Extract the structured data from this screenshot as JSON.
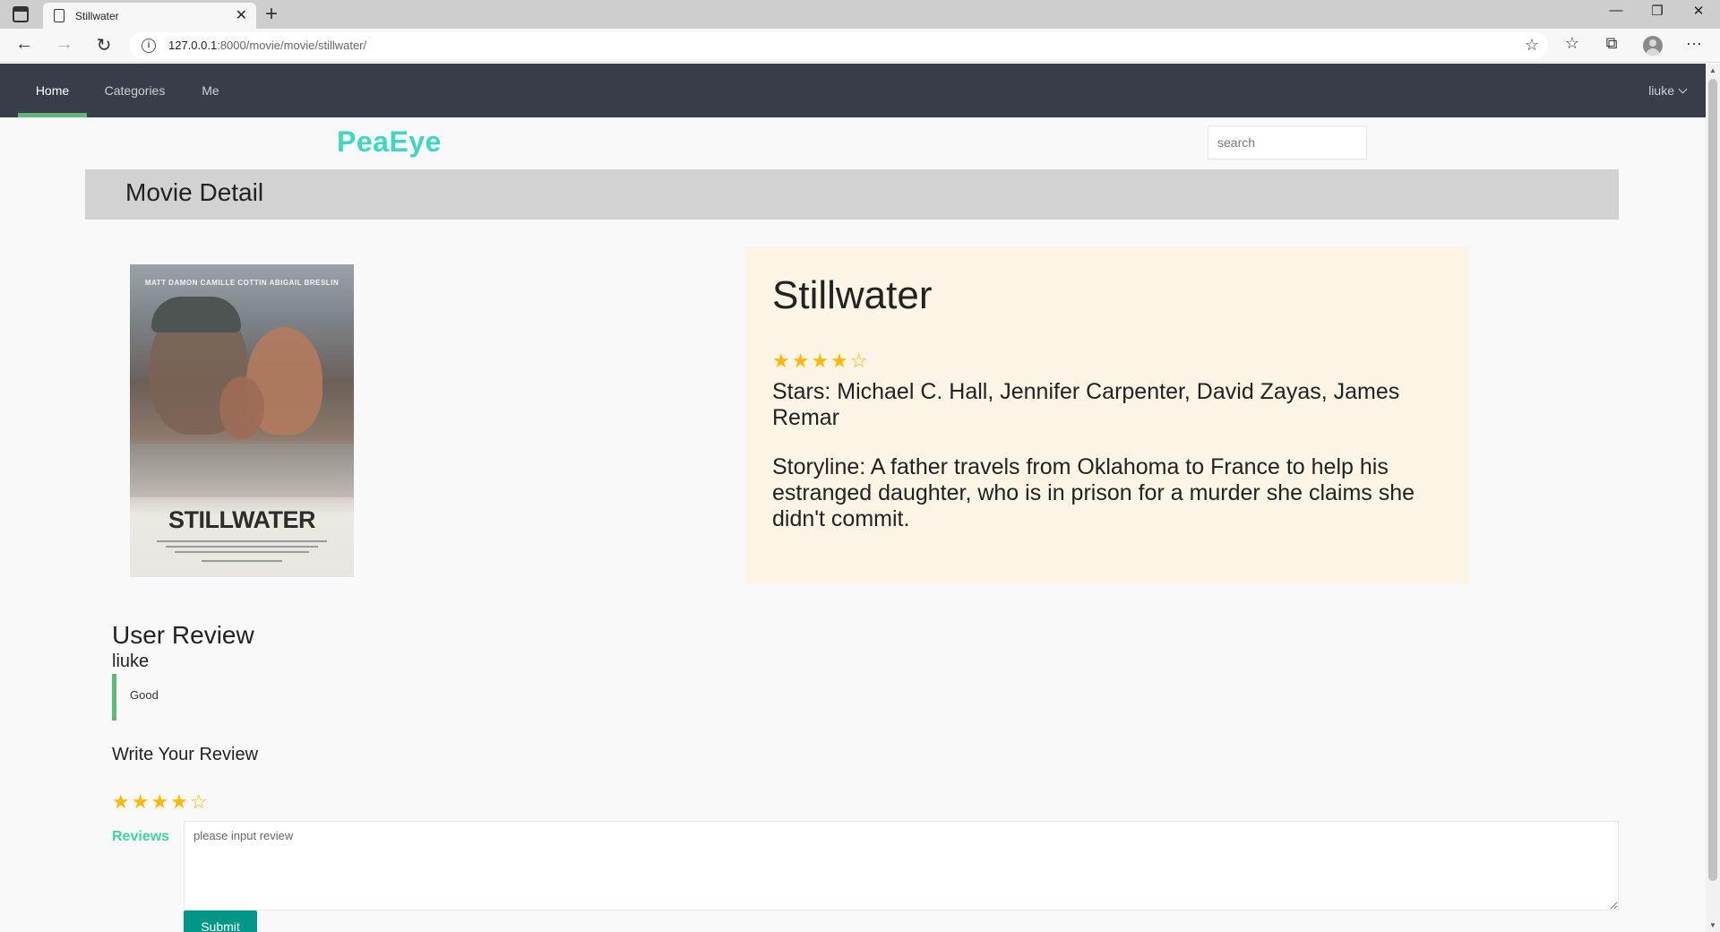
{
  "browser": {
    "tab_title": "Stillwater",
    "tab_close": "✕",
    "new_tab": "+",
    "url_host": "127.0.0.1",
    "url_rest": ":8000/movie/movie/stillwater/",
    "info_glyph": "i",
    "window_controls": {
      "minimize": "—",
      "restore": "❐",
      "close": "✕"
    },
    "nav_glyphs": {
      "back": "←",
      "forward": "→",
      "reload": "↻",
      "more": "···"
    }
  },
  "site_nav": {
    "items": [
      {
        "label": "Home",
        "active": true
      },
      {
        "label": "Categories",
        "active": false
      },
      {
        "label": "Me",
        "active": false
      }
    ],
    "user": "liuke"
  },
  "header": {
    "logo": "PeaEye",
    "search_placeholder": "search"
  },
  "detail_bar": {
    "title": "Movie Detail"
  },
  "poster": {
    "credits": "MATT DAMON     CAMILLE COTTIN     ABIGAIL BRESLIN",
    "title": "STILLWATER"
  },
  "movie": {
    "title": "Stillwater",
    "rating": {
      "filled": 4,
      "total": 5,
      "display": "★★★★☆"
    },
    "stars": "Stars: Michael C. Hall, Jennifer Carpenter, David Zayas, James Remar",
    "storyline": "Storyline: A father travels from Oklahoma to France to help his estranged daughter, who is in prison for a murder she claims she didn't commit."
  },
  "reviews": {
    "heading": "User Review",
    "items": [
      {
        "user": "liuke",
        "text": "Good"
      }
    ]
  },
  "write_review": {
    "heading": "Write Your Review",
    "rating": {
      "filled": 4,
      "total": 5,
      "display": "★★★★☆"
    },
    "label": "Reviews",
    "placeholder": "please input review",
    "submit_label": "Submit"
  },
  "colors": {
    "nav_bg": "#393d49",
    "nav_active_underline": "#5fb878",
    "logo": "#40d6c4",
    "star": "#ffb800",
    "info_card_bg": "#fcf5e6",
    "submit_bg": "#009688"
  }
}
